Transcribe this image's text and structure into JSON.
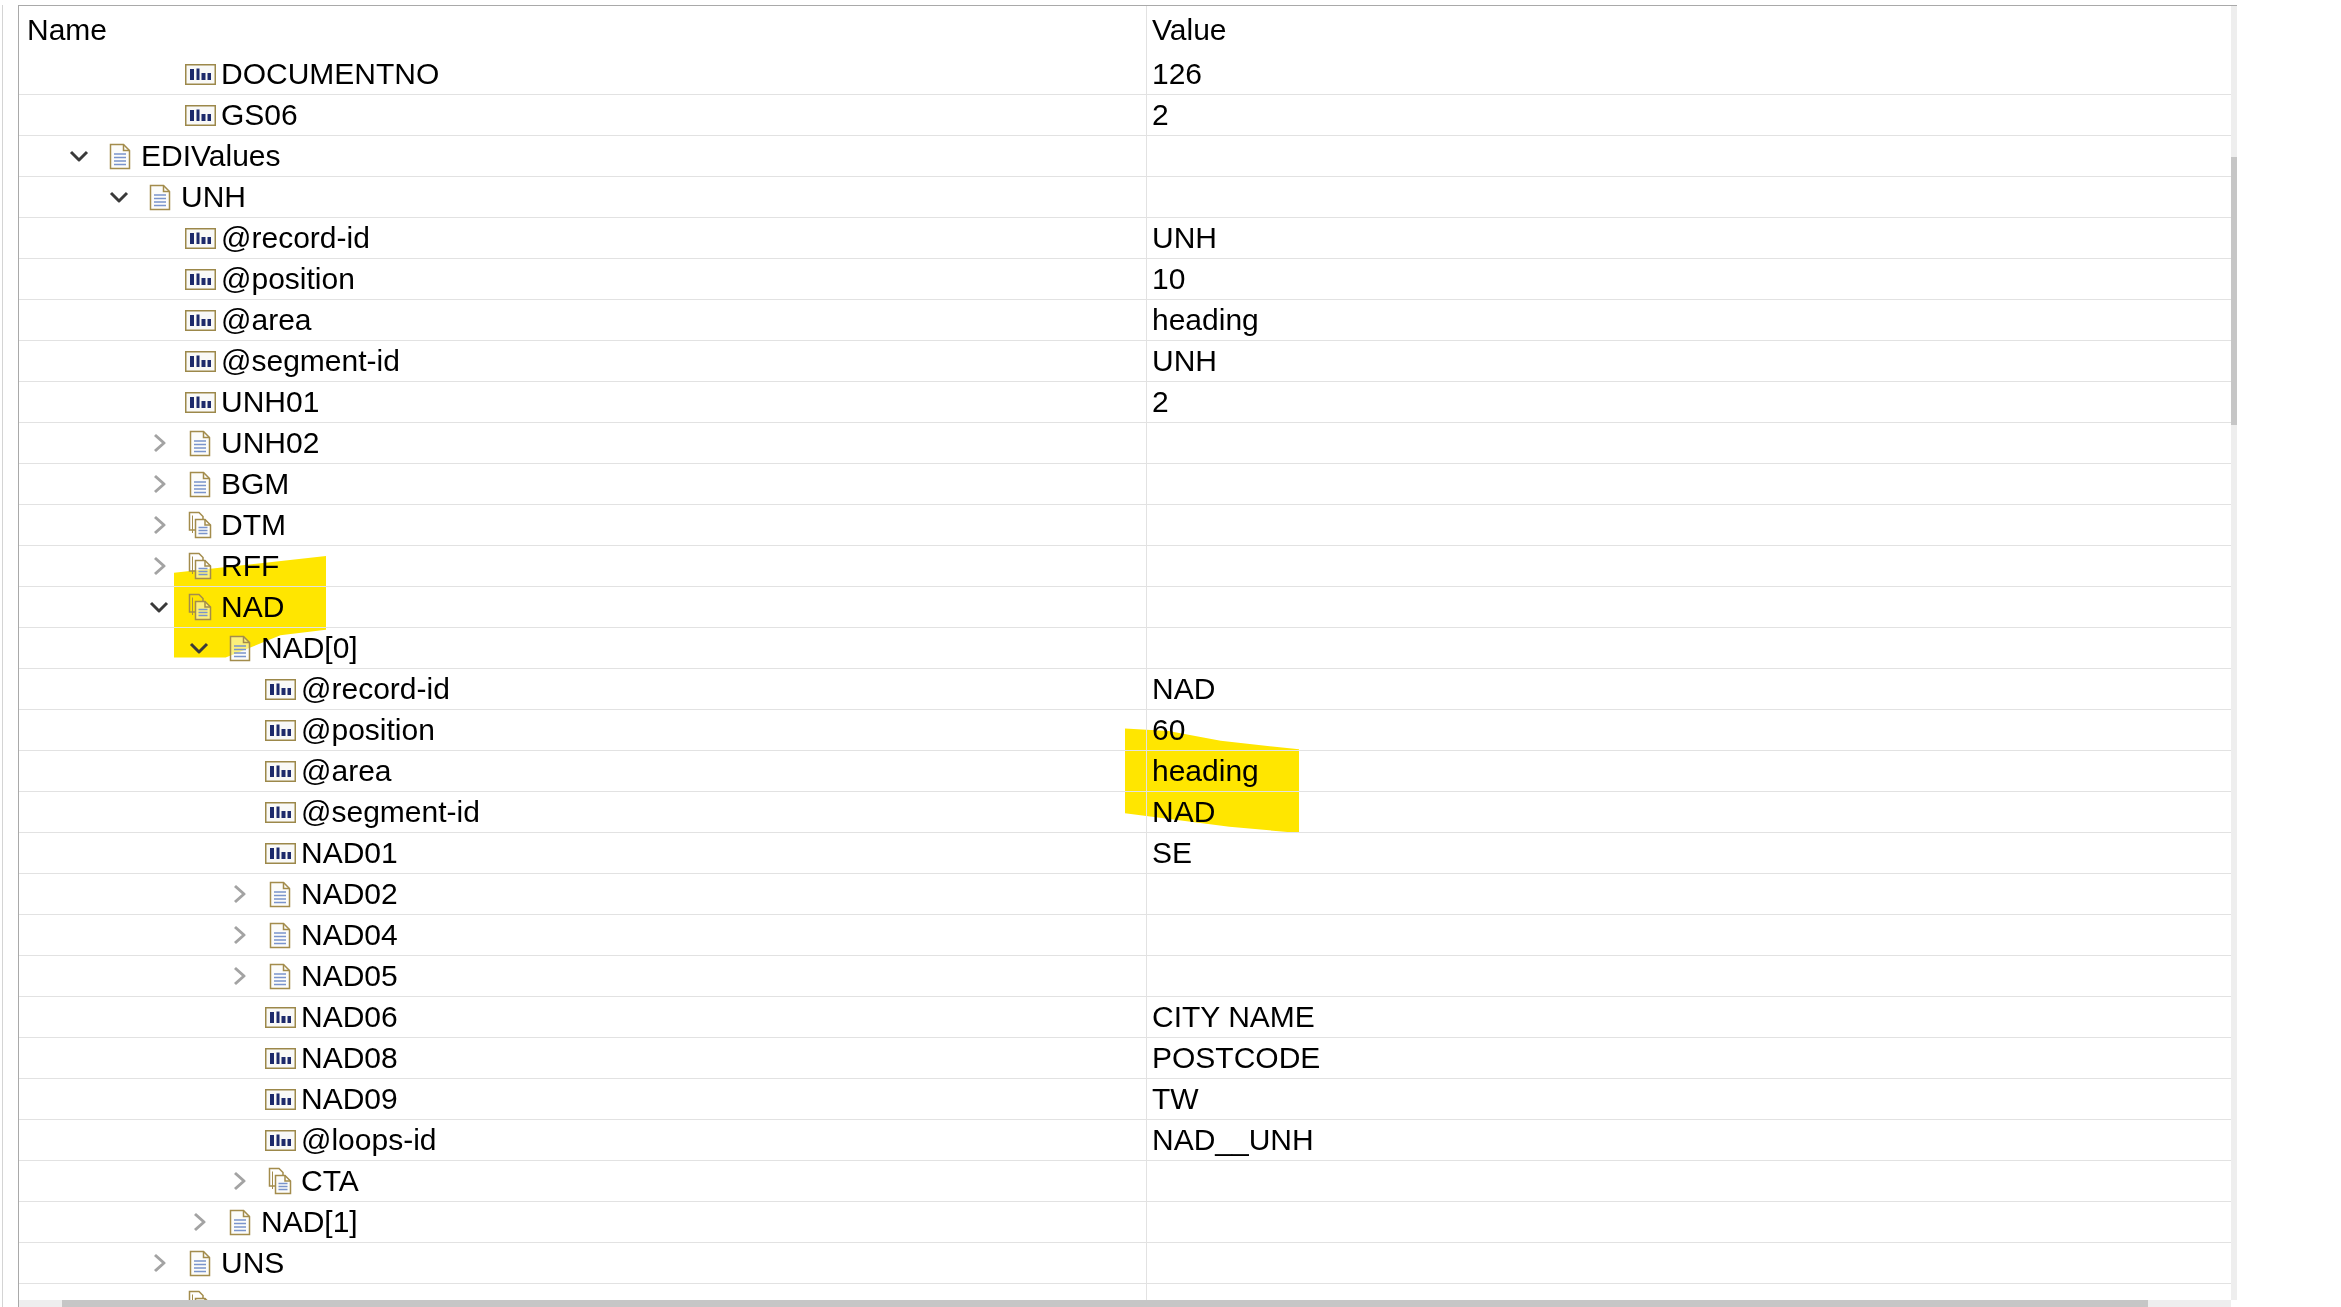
{
  "columns": [
    {
      "label": "Name"
    },
    {
      "label": "Value"
    }
  ],
  "tree": [
    {
      "children": [
        {
          "children": [
            {
              "kind": "field",
              "name": "DOCUMENTNO",
              "value": "126"
            },
            {
              "kind": "field",
              "name": "GS06",
              "value": "2"
            }
          ]
        }
      ]
    },
    {
      "kind": "record",
      "name": "EDIValues",
      "expanded": true,
      "children": [
        {
          "kind": "record",
          "name": "UNH",
          "expanded": true,
          "children": [
            {
              "kind": "field",
              "name": "@record-id",
              "value": "UNH",
              "name_highlighted": false
            },
            {
              "kind": "field",
              "name": "@position",
              "value": "10",
              "name_highlighted": false
            },
            {
              "kind": "field",
              "name": "@area",
              "value": "heading",
              "name_highlighted": false
            },
            {
              "kind": "field",
              "name": "@segment-id",
              "value": "UNH",
              "name_highlighted": false
            },
            {
              "kind": "field",
              "name": "UNH01",
              "value": "2",
              "name_highlighted": false
            },
            {
              "kind": "record",
              "name": "UNH02",
              "expanded": false,
              "name_highlighted": false
            },
            {
              "kind": "record",
              "name": "BGM",
              "expanded": false,
              "name_highlighted": false
            },
            {
              "kind": "group",
              "name": "DTM",
              "expanded": false,
              "name_highlighted": false
            },
            {
              "kind": "group",
              "name": "RFF",
              "expanded": false,
              "name_highlighted": true
            },
            {
              "kind": "group",
              "name": "NAD",
              "expanded": true,
              "name_highlighted": true,
              "children": [
                {
                  "kind": "record",
                  "name": "NAD[0]",
                  "expanded": true,
                  "name_highlighted": true,
                  "children": [
                    {
                      "kind": "field",
                      "name": "@record-id",
                      "value": "NAD",
                      "value_highlighted": false
                    },
                    {
                      "kind": "field",
                      "name": "@position",
                      "value": "60",
                      "value_highlighted": true
                    },
                    {
                      "kind": "field",
                      "name": "@area",
                      "value": "heading",
                      "value_highlighted": true
                    },
                    {
                      "kind": "field",
                      "name": "@segment-id",
                      "value": "NAD",
                      "value_highlighted": true
                    },
                    {
                      "kind": "field",
                      "name": "NAD01",
                      "value": "SE",
                      "value_highlighted": false
                    },
                    {
                      "kind": "record",
                      "name": "NAD02",
                      "expanded": false,
                      "value_highlighted": false
                    },
                    {
                      "kind": "record",
                      "name": "NAD04",
                      "expanded": false,
                      "value_highlighted": false
                    },
                    {
                      "kind": "record",
                      "name": "NAD05",
                      "expanded": false,
                      "value_highlighted": false
                    },
                    {
                      "kind": "field",
                      "name": "NAD06",
                      "value": "CITY NAME",
                      "value_highlighted": false
                    },
                    {
                      "kind": "field",
                      "name": "NAD08",
                      "value": "POSTCODE",
                      "value_highlighted": false
                    },
                    {
                      "kind": "field",
                      "name": "NAD09",
                      "value": "TW",
                      "value_highlighted": false
                    },
                    {
                      "kind": "field",
                      "name": "@loops-id",
                      "value": "NAD__UNH",
                      "value_highlighted": false
                    },
                    {
                      "kind": "group",
                      "name": "CTA",
                      "expanded": false,
                      "value_highlighted": false
                    }
                  ]
                },
                {
                  "kind": "record",
                  "name": "NAD[1]",
                  "expanded": false,
                  "name_highlighted": false
                }
              ]
            },
            {
              "kind": "record",
              "name": "UNS",
              "expanded": false,
              "name_highlighted": false
            },
            {
              "kind": "group",
              "name_highlighted": false
            }
          ]
        }
      ]
    }
  ]
}
